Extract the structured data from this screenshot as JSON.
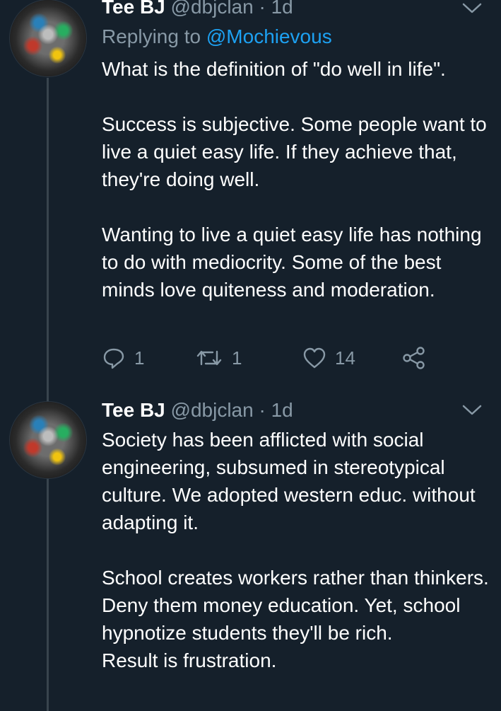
{
  "tweets": [
    {
      "name": "Tee BJ",
      "handle": "@dbjclan",
      "separator": "·",
      "time": "1d",
      "reply_prefix": "Replying to",
      "reply_mention": "@Mochievous",
      "paragraphs": [
        "What is the definition of \"do well in life\".",
        "Success is subjective. Some people want to live a quiet easy life. If they achieve that, they're doing well.",
        "Wanting to live a quiet easy life has nothing to do with mediocrity. Some of the best minds love quiteness and moderation."
      ],
      "actions": {
        "reply_count": "1",
        "retweet_count": "1",
        "like_count": "14"
      }
    },
    {
      "name": "Tee BJ",
      "handle": "@dbjclan",
      "separator": "·",
      "time": "1d",
      "paragraphs": [
        "Society has been afflicted with social engineering, subsumed in stereotypical culture. We adopted western educ. without adapting it.",
        "School creates workers rather than thinkers. Deny them money education. Yet, school hypnotize students they'll be rich.",
        "Result is frustration."
      ]
    }
  ],
  "icons": {
    "chevron": "chevron-down-icon",
    "reply": "reply-icon",
    "retweet": "retweet-icon",
    "like": "heart-icon",
    "share": "share-icon"
  },
  "colors": {
    "background": "#15202b",
    "text": "#ffffff",
    "muted": "#8899a6",
    "link": "#1da1f2",
    "thread_line": "#38444d"
  }
}
